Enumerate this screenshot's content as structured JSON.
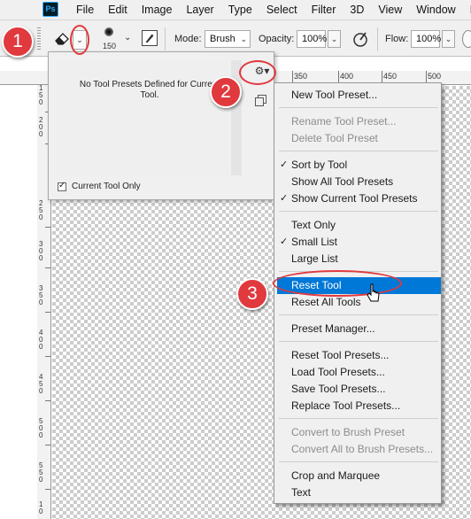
{
  "app": {
    "logo": "Ps"
  },
  "menubar": {
    "items": [
      "File",
      "Edit",
      "Image",
      "Layer",
      "Type",
      "Select",
      "Filter",
      "3D",
      "View",
      "Window",
      "Help"
    ]
  },
  "options": {
    "brush_size": "150",
    "mode_label": "Mode:",
    "mode_value": "Brush",
    "opacity_label": "Opacity:",
    "opacity_value": "100%",
    "flow_label": "Flow:",
    "flow_value": "100%"
  },
  "ruler": {
    "top_labels": [
      "350",
      "400",
      "450",
      "500"
    ]
  },
  "preset_panel": {
    "empty_message": "No Tool Presets Defined for Current Tool.",
    "current_only_label": "Current Tool Only",
    "current_only_checked": true
  },
  "menu": {
    "items": [
      {
        "label": "New Tool Preset...",
        "enabled": true
      },
      {
        "label": "Rename Tool Preset...",
        "enabled": false
      },
      {
        "label": "Delete Tool Preset",
        "enabled": false
      },
      {
        "label": "Sort by Tool",
        "enabled": true,
        "checked": true
      },
      {
        "label": "Show All Tool Presets",
        "enabled": true
      },
      {
        "label": "Show Current Tool Presets",
        "enabled": true,
        "checked": true
      },
      {
        "label": "Text Only",
        "enabled": true
      },
      {
        "label": "Small List",
        "enabled": true,
        "checked": true
      },
      {
        "label": "Large List",
        "enabled": true
      },
      {
        "label": "Reset Tool",
        "enabled": true,
        "highlighted": true
      },
      {
        "label": "Reset All Tools",
        "enabled": true
      },
      {
        "label": "Preset Manager...",
        "enabled": true
      },
      {
        "label": "Reset Tool Presets...",
        "enabled": true
      },
      {
        "label": "Load Tool Presets...",
        "enabled": true
      },
      {
        "label": "Save Tool Presets...",
        "enabled": true
      },
      {
        "label": "Replace Tool Presets...",
        "enabled": true
      },
      {
        "label": "Convert to Brush Preset",
        "enabled": false
      },
      {
        "label": "Convert All to Brush Presets...",
        "enabled": false
      },
      {
        "label": "Crop and Marquee",
        "enabled": true
      },
      {
        "label": "Text",
        "enabled": true
      }
    ]
  },
  "annotations": {
    "badges": [
      "1",
      "2",
      "3"
    ]
  },
  "colors": {
    "badge_red": "#e0393e",
    "menu_highlight": "#0078d7",
    "ps_blue": "#31a8ff"
  }
}
